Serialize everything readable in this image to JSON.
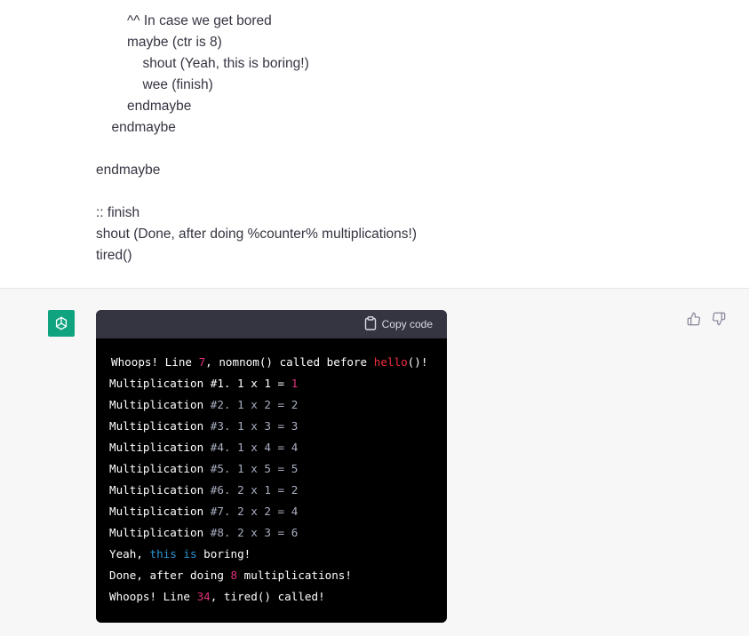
{
  "user_message": {
    "lines": [
      {
        "text": "^^ In case we get bored",
        "indent": 2
      },
      {
        "text": "maybe (ctr is 8)",
        "indent": 2
      },
      {
        "text": "shout (Yeah, this is boring!)",
        "indent": 3
      },
      {
        "text": "wee (finish)",
        "indent": 3
      },
      {
        "text": "endmaybe",
        "indent": 2
      },
      {
        "text": "endmaybe",
        "indent": 1
      },
      {
        "text": "",
        "indent": 0
      },
      {
        "text": "endmaybe",
        "indent": 0
      },
      {
        "text": "",
        "indent": 0
      },
      {
        "text": ":: finish",
        "indent": 0
      },
      {
        "text": "shout (Done, after doing %counter% multiplications!)",
        "indent": 0
      },
      {
        "text": "tired()",
        "indent": 0
      }
    ]
  },
  "assistant": {
    "avatar_icon": "openai-logo-icon",
    "code_block": {
      "copy_label": "Copy code",
      "copy_icon": "clipboard-icon",
      "lines": [
        [
          {
            "t": "Whoops! Line ",
            "c": "plain"
          },
          {
            "t": "7",
            "c": "num"
          },
          {
            "t": ", nomnom() called before ",
            "c": "plain"
          },
          {
            "t": "hello",
            "c": "kw"
          },
          {
            "t": "()!",
            "c": "plain"
          }
        ],
        [
          {
            "t": "Multiplication #1. 1 x 1 = ",
            "c": "plain"
          },
          {
            "t": "1",
            "c": "num"
          }
        ],
        [
          {
            "t": "Multiplication ",
            "c": "plain"
          },
          {
            "t": "#2. 1 x 2 = 2",
            "c": "dim"
          }
        ],
        [
          {
            "t": "Multiplication ",
            "c": "plain"
          },
          {
            "t": "#3. 1 x 3 = 3",
            "c": "dim"
          }
        ],
        [
          {
            "t": "Multiplication ",
            "c": "plain"
          },
          {
            "t": "#4. 1 x 4 = 4",
            "c": "dim"
          }
        ],
        [
          {
            "t": "Multiplication ",
            "c": "plain"
          },
          {
            "t": "#5. 1 x 5 = 5",
            "c": "dim"
          }
        ],
        [
          {
            "t": "Multiplication ",
            "c": "plain"
          },
          {
            "t": "#6. 2 x 1 = 2",
            "c": "dim"
          }
        ],
        [
          {
            "t": "Multiplication ",
            "c": "plain"
          },
          {
            "t": "#7. 2 x 2 = 4",
            "c": "dim"
          }
        ],
        [
          {
            "t": "Multiplication ",
            "c": "plain"
          },
          {
            "t": "#8. 2 x 3 = 6",
            "c": "dim"
          }
        ],
        [
          {
            "t": "Yeah, ",
            "c": "plain"
          },
          {
            "t": "this is",
            "c": "blue"
          },
          {
            "t": " boring!",
            "c": "plain"
          }
        ],
        [
          {
            "t": "Done, after doing ",
            "c": "plain"
          },
          {
            "t": "8",
            "c": "num"
          },
          {
            "t": " multiplications!",
            "c": "plain"
          }
        ],
        [
          {
            "t": "Whoops! Line ",
            "c": "plain"
          },
          {
            "t": "34",
            "c": "num"
          },
          {
            "t": ", tired() called!",
            "c": "plain"
          }
        ]
      ]
    },
    "feedback": {
      "thumbs_up_icon": "thumbs-up-icon",
      "thumbs_down_icon": "thumbs-down-icon"
    }
  },
  "colors": {
    "user_text": "#343541",
    "assistant_bg": "#f7f7f8",
    "avatar_bg": "#10a37f",
    "code_bg": "#000000",
    "code_header_bg": "#343541",
    "code_plain": "#ffffff",
    "code_num": "#df3079",
    "code_kw": "#f22c3d",
    "code_dim": "#a9aec1",
    "code_blue": "#2e95d3"
  }
}
